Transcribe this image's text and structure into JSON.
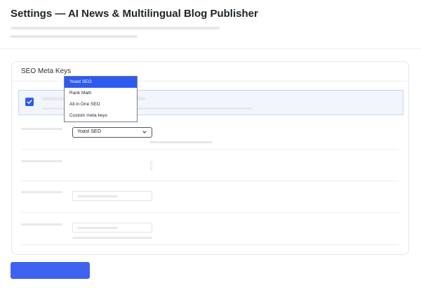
{
  "header": {
    "title": "Settings — AI News & Multilingual Blog Publisher"
  },
  "seo_card": {
    "title": "SEO Meta Keys",
    "override_checkbox": {
      "checked": true
    },
    "meta_plugin_select": {
      "selected_value": "Yoast SEO",
      "options": [
        "Yoast SEO",
        "Rank Math",
        "All in One SEO",
        "Custom meta keys"
      ],
      "open": true
    }
  },
  "colors": {
    "accent": "#2d5bef",
    "primary_button": "#3f63f0",
    "highlight_bg": "#f1f5fc",
    "placeholder": "#e6e8eb"
  },
  "icons": {
    "checkbox": "checkmark-icon",
    "select": "chevron-down-icon"
  }
}
